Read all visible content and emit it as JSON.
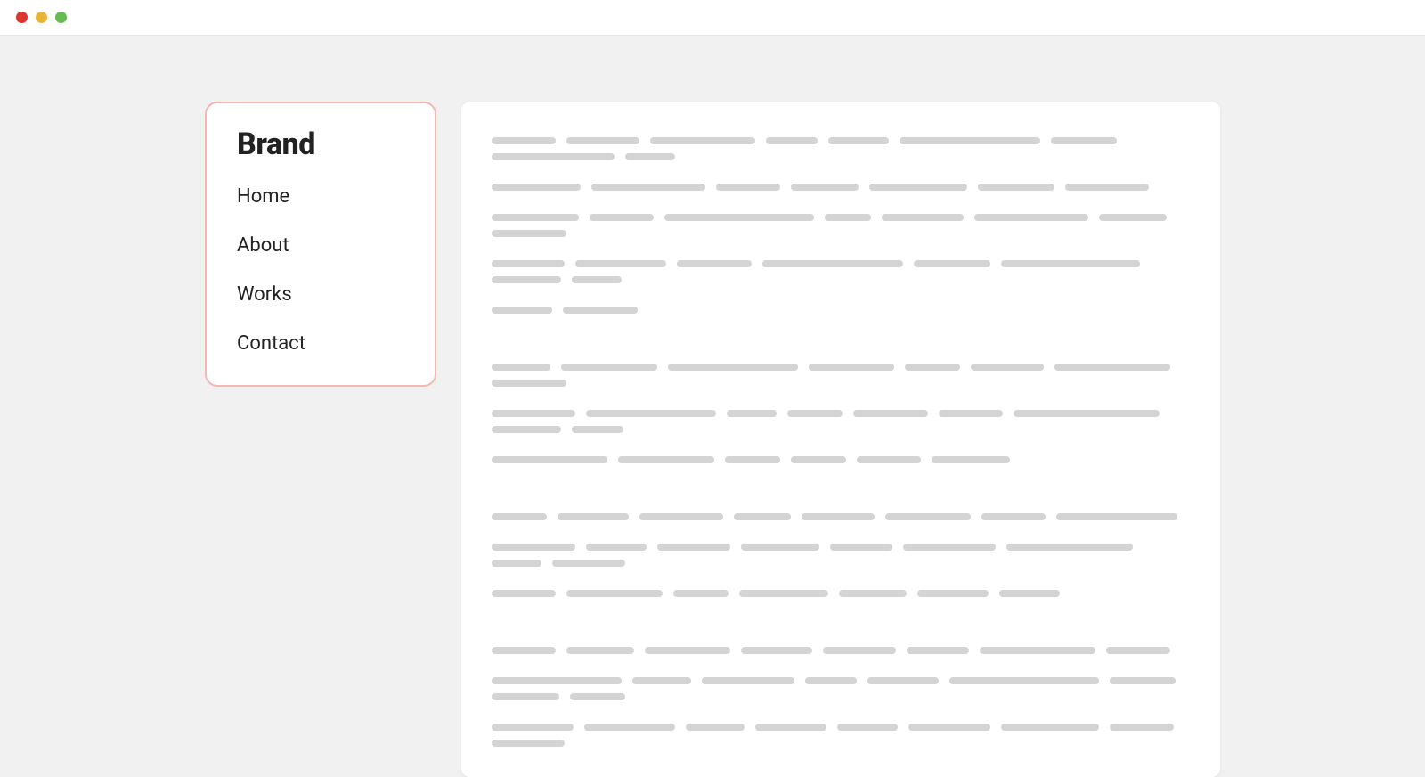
{
  "window": {
    "traffic_lights": [
      "close",
      "minimize",
      "zoom"
    ]
  },
  "sidebar": {
    "brand": "Brand",
    "items": [
      {
        "label": "Home"
      },
      {
        "label": "About"
      },
      {
        "label": "Works"
      },
      {
        "label": "Contact"
      }
    ]
  },
  "content": {
    "paragraphs": [
      {
        "rows": [
          [
            72,
            82,
            118,
            58,
            68,
            158,
            74,
            138,
            56
          ],
          [
            100,
            128,
            72,
            76,
            110,
            86,
            94
          ],
          [
            98,
            72,
            168,
            52,
            92,
            128,
            76,
            84
          ],
          [
            82,
            102,
            84,
            158,
            86,
            156,
            78,
            56
          ],
          [
            68,
            84
          ]
        ]
      },
      {
        "rows": [
          [
            66,
            108,
            146,
            96,
            62,
            82,
            130,
            84
          ],
          [
            94,
            146,
            56,
            62,
            84,
            72,
            164,
            78,
            58
          ],
          [
            130,
            108,
            62,
            62,
            72,
            88
          ]
        ]
      },
      {
        "rows": [
          [
            62,
            80,
            94,
            64,
            82,
            96,
            72,
            136
          ],
          [
            94,
            68,
            82,
            88,
            70,
            104,
            142,
            56,
            82
          ],
          [
            72,
            108,
            62,
            100,
            76,
            80,
            68
          ]
        ]
      },
      {
        "rows": [
          [
            72,
            76,
            96,
            80,
            82,
            70,
            130,
            72
          ],
          [
            146,
            66,
            104,
            58,
            80,
            168,
            74,
            76,
            62
          ],
          [
            92,
            102,
            66,
            80,
            68,
            92,
            110,
            72,
            82
          ]
        ]
      }
    ]
  }
}
